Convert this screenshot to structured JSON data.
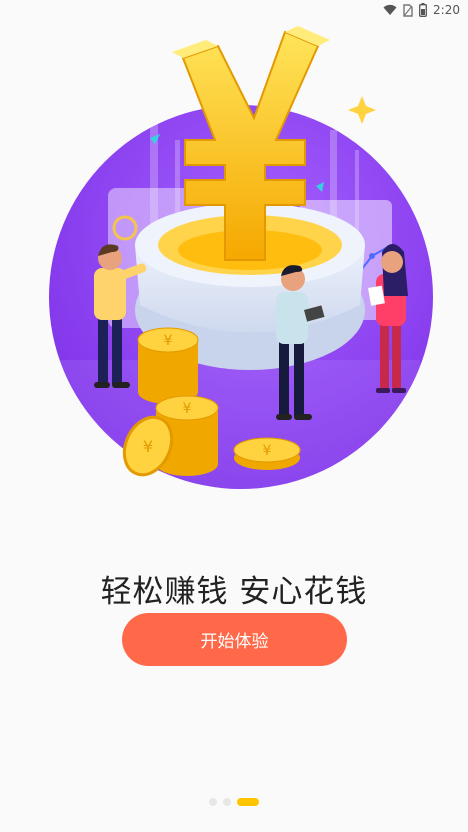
{
  "status_bar": {
    "time": "2:20",
    "icons": [
      "wifi-icon",
      "no-sim-icon",
      "battery-icon"
    ]
  },
  "hero": {
    "icon": "yuan-coin-illustration",
    "colors": {
      "circle": "#8a3ff0",
      "circle_light": "#a560ff",
      "gold": "#ffc21a",
      "gold_dark": "#f0a000"
    }
  },
  "onboarding": {
    "tagline": "轻松赚钱 安心花钱",
    "start_button_label": "开始体验",
    "page_indicator": {
      "current": 3,
      "total": 3
    }
  },
  "colors": {
    "accent": "#ff6949",
    "indicator_active": "#ffc400",
    "indicator_inactive": "#e6e6e6"
  }
}
